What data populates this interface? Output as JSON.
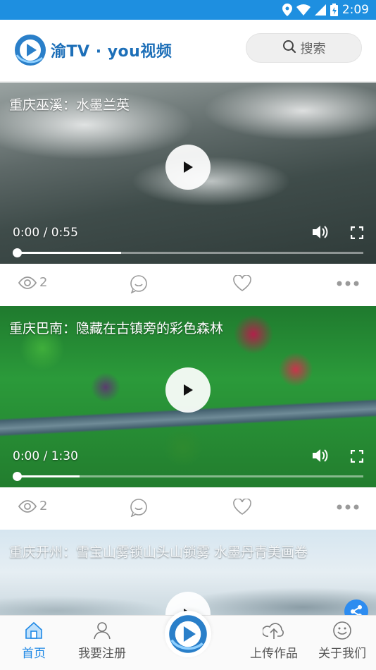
{
  "status_bar": {
    "time": "2:09"
  },
  "header": {
    "brand": "渝TV · you视频",
    "search_label": "搜索"
  },
  "videos": [
    {
      "title": "重庆巫溪：水墨兰英",
      "time": "0:00 / 0:55",
      "progress": 0.3,
      "views": "2"
    },
    {
      "title": "重庆巴南：隐藏在古镇旁的彩色森林",
      "time": "0:00 / 1:30",
      "progress": 0.18,
      "views": "2"
    },
    {
      "title": "重庆开州：雪宝山雾锁山头山锁雾 水墨丹青美画卷"
    }
  ],
  "tabs": [
    {
      "label": "首页",
      "icon": "home-icon",
      "active": true
    },
    {
      "label": "我要注册",
      "icon": "user-icon",
      "active": false
    },
    {
      "label": "上传作品",
      "icon": "upload-cloud-icon",
      "active": false
    },
    {
      "label": "关于我们",
      "icon": "smile-icon",
      "active": false
    }
  ],
  "colors": {
    "accent": "#1e88e5",
    "status_bar": "#1e8fe0",
    "brand": "#1d6fb8"
  }
}
